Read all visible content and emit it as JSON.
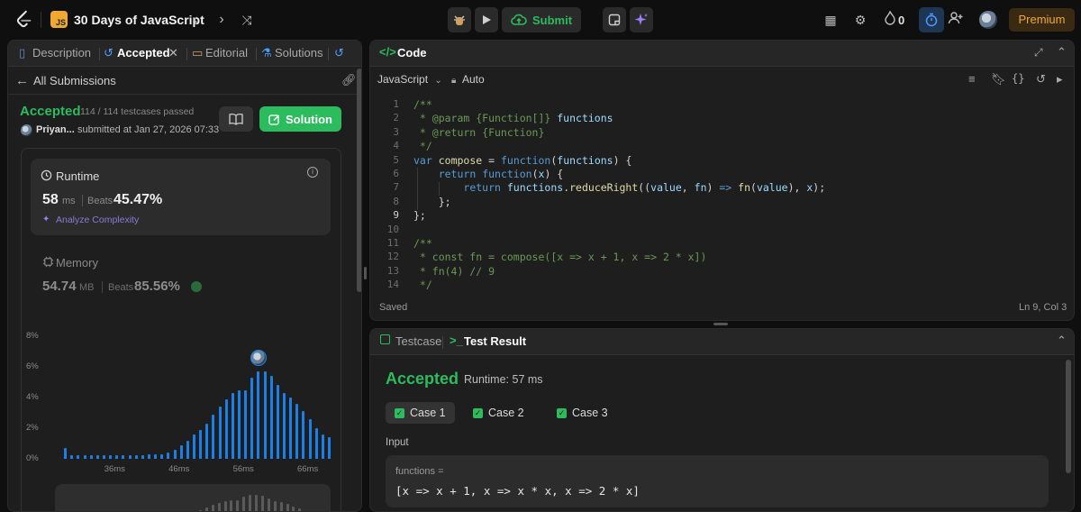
{
  "topbar": {
    "app_title": "30 Days of JavaScript",
    "js_badge": "JS",
    "submit_label": "Submit",
    "streak_count": "0",
    "premium_label": "Premium"
  },
  "left_panel": {
    "tabs": [
      {
        "label": "Description"
      },
      {
        "label": "Accepted"
      },
      {
        "label": "Editorial"
      },
      {
        "label": "Solutions"
      }
    ],
    "back_label": "All Submissions",
    "status": "Accepted",
    "testcases": "114 / 114 testcases passed",
    "user_name": "Priyan...",
    "submitted_at": "submitted at Jan 27, 2026 07:33",
    "solution_button": "Solution",
    "runtime": {
      "label": "Runtime",
      "value": "58",
      "unit": "ms",
      "beats_label": "Beats",
      "beats_value": "45.47%",
      "analyze_label": "Analyze Complexity"
    },
    "memory": {
      "label": "Memory",
      "value": "54.74",
      "unit": "MB",
      "beats_label": "Beats",
      "beats_value": "85.56%"
    }
  },
  "chart_data": {
    "type": "bar",
    "y_tick_labels": [
      "8%",
      "6%",
      "4%",
      "2%",
      "0%"
    ],
    "ylim": [
      0,
      8
    ],
    "x_tick_labels": [
      "36ms",
      "46ms",
      "56ms",
      "66ms"
    ],
    "x_tick_values": [
      36,
      46,
      56,
      66
    ],
    "x": [
      28,
      29,
      30,
      31,
      32,
      33,
      34,
      35,
      36,
      37,
      38,
      39,
      40,
      41,
      42,
      43,
      44,
      45,
      46,
      47,
      48,
      49,
      50,
      51,
      52,
      53,
      54,
      55,
      56,
      57,
      58,
      59,
      60,
      61,
      62,
      63,
      64,
      65,
      66,
      67,
      68,
      69
    ],
    "values": [
      0.7,
      0.25,
      0.25,
      0.25,
      0.25,
      0.25,
      0.25,
      0.25,
      0.25,
      0.25,
      0.25,
      0.25,
      0.25,
      0.3,
      0.3,
      0.3,
      0.4,
      0.6,
      0.9,
      1.2,
      1.6,
      1.9,
      2.3,
      2.9,
      3.4,
      3.9,
      4.3,
      4.5,
      4.5,
      5.3,
      5.7,
      5.7,
      5.4,
      4.8,
      4.3,
      4.0,
      3.6,
      3.1,
      2.6,
      2.0,
      1.6,
      1.4
    ],
    "highlight_x": 58
  },
  "code_panel": {
    "title": "Code",
    "language": "JavaScript",
    "mode": "Auto",
    "saved_label": "Saved",
    "cursor_pos": "Ln 9, Col 3",
    "line_numbers": [
      "1",
      "2",
      "3",
      "4",
      "5",
      "6",
      "7",
      "8",
      "9",
      "10",
      "11",
      "12",
      "13",
      "14"
    ]
  },
  "result_panel": {
    "tab_testcase": "Testcase",
    "tab_result": "Test Result",
    "status": "Accepted",
    "runtime": "Runtime: 57 ms",
    "cases": [
      "Case 1",
      "Case 2",
      "Case 3"
    ],
    "input_label": "Input",
    "input_var": "functions =",
    "input_value": "[x => x + 1, x => x * x, x => 2 * x]"
  }
}
